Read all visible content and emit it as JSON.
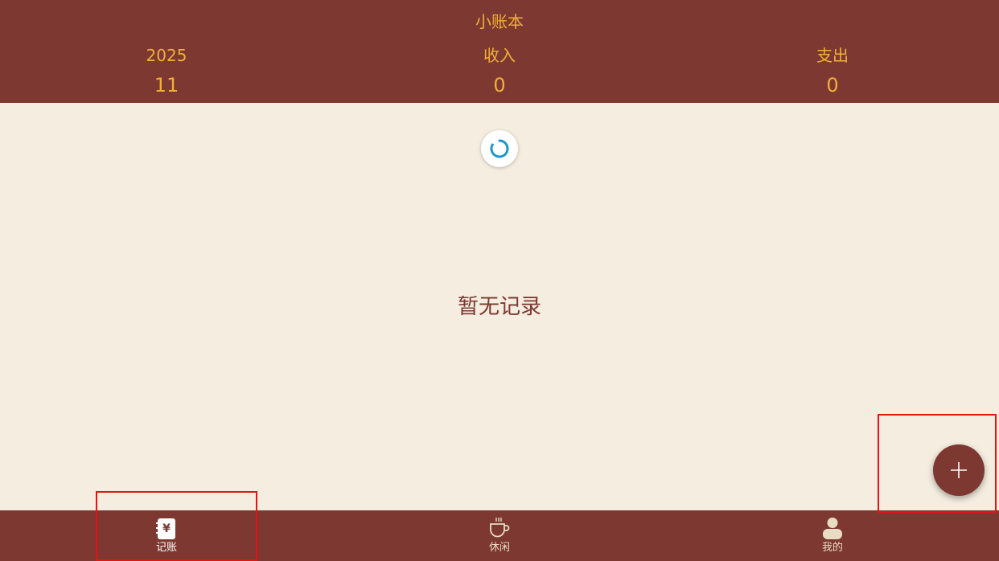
{
  "header": {
    "title": "小账本",
    "year": "2025",
    "month": "11",
    "income_label": "收入",
    "income_value": "0",
    "expense_label": "支出",
    "expense_value": "0"
  },
  "main": {
    "empty_text": "暂无记录"
  },
  "bottom_nav": {
    "items": [
      {
        "label": "记账",
        "icon": "ledger-yen-icon"
      },
      {
        "label": "休闲",
        "icon": "coffee-cup-icon"
      },
      {
        "label": "我的",
        "icon": "person-icon"
      }
    ]
  },
  "colors": {
    "primary": "#7d3831",
    "accent": "#f0b03a",
    "background": "#f5eddf",
    "spinner": "#1b98c9",
    "highlight": "#e31414"
  }
}
